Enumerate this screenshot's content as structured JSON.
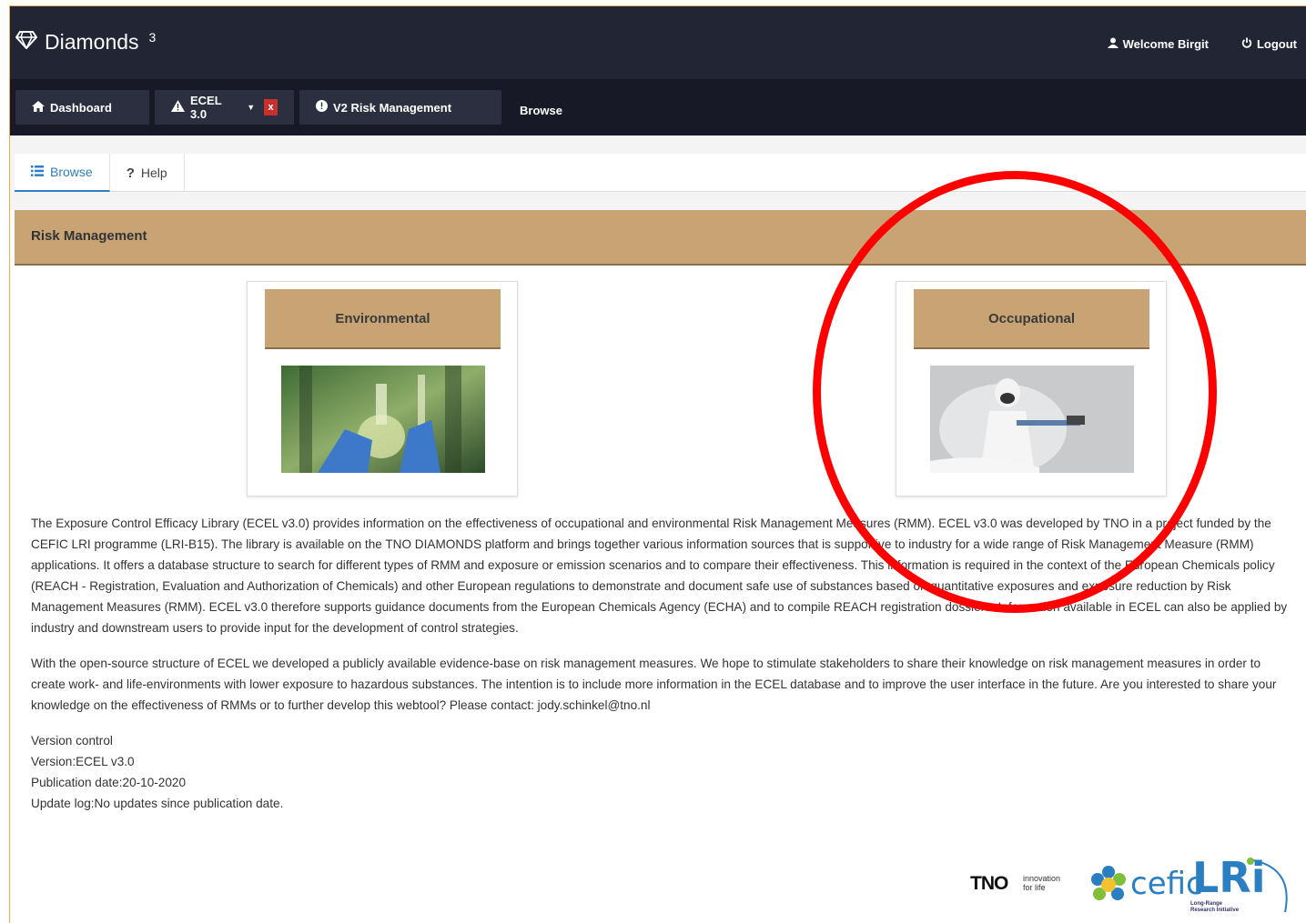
{
  "app": {
    "name": "Diamonds",
    "version_sup": "3"
  },
  "user_menu": {
    "welcome": "Welcome Birgit",
    "logout": "Logout"
  },
  "nav": {
    "dashboard": "Dashboard",
    "ecel": "ECEL 3.0",
    "ecel_close": "x",
    "v2": "V2 Risk Management",
    "browse": "Browse"
  },
  "tabs": {
    "browse": "Browse",
    "help": "Help"
  },
  "section": {
    "title": "Risk Management"
  },
  "cards": {
    "environmental": "Environmental",
    "occupational": "Occupational"
  },
  "content": {
    "paragraph1": "The Exposure Control Efficacy Library (ECEL v3.0) provides information on the effectiveness of occupational and environmental Risk Management Measures (RMM). ECEL v3.0 was developed by TNO in a project funded by the CEFIC LRI programme (LRI-B15). The library is available on the TNO DIAMONDS platform and brings together various information sources that is supportive to industry for a wide range of Risk Management Measure (RMM) applications. It offers a database structure to search for different types of RMM and exposure or emission scenarios and to compare their effectiveness. This information is required in the context of the European Chemicals policy (REACH - Registration, Evaluation and Authorization of Chemicals) and other European regulations to demonstrate and document safe use of substances based on quantitative exposures and exposure reduction by Risk Management Measures (RMM). ECEL v3.0 therefore supports guidance documents from the European Chemicals Agency (ECHA) and to compile REACH registration dossiers. Information available in ECEL can also be applied by industry and downstream users to provide input for the development of control strategies.",
    "paragraph2": "With the open-source structure of ECEL we developed a publicly available evidence-base on risk management measures. We hope to stimulate stakeholders to share their knowledge on risk management measures in order to create work- and life-environments with lower exposure to hazardous substances. The intention is to include more information in the ECEL database and to improve the user interface in the future. Are you interested to share your knowledge on the effectiveness of RMMs or to further develop this webtool? Please contact: jody.schinkel@tno.nl",
    "version_title": "Version control",
    "version": "Version:ECEL v3.0",
    "publication": "Publication date:20-10-2020",
    "update_log": "Update log:No updates since publication date."
  },
  "logos": {
    "tno": "TNO",
    "tno_tagline_1": "innovation",
    "tno_tagline_2": "for life",
    "cefic": "cefic",
    "lri": "LRi",
    "lri_sub_1": "Long-Range",
    "lri_sub_2": "Research Initiative"
  },
  "colors": {
    "header_bg": "#212534",
    "nav_bg": "#171a26",
    "accent_tan": "#c8a475",
    "active_tab": "#2f7ec1",
    "annotation": "#ff0000"
  }
}
